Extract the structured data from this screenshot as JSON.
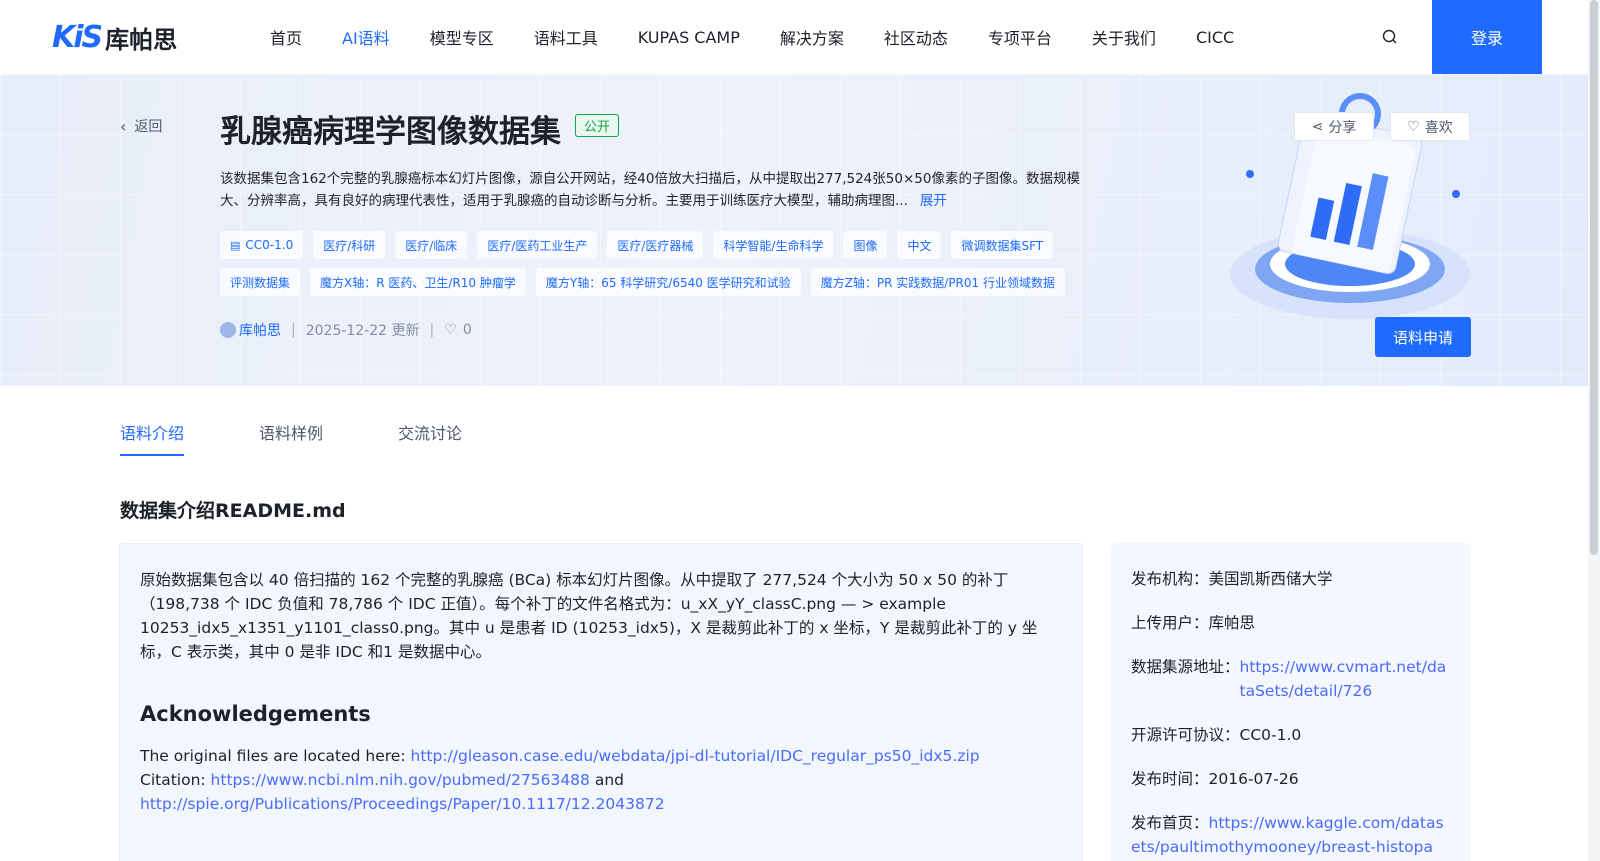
{
  "header": {
    "logo_mark": "KiS",
    "logo_text": "库帕思",
    "nav": [
      "首页",
      "AI语料",
      "模型专区",
      "语料工具",
      "KUPAS CAMP",
      "解决方案",
      "社区动态",
      "专项平台",
      "关于我们",
      "CICC"
    ],
    "active_index": 1,
    "login": "登录"
  },
  "hero": {
    "back": "返回",
    "title": "乳腺癌病理学图像数据集",
    "badge": "公开",
    "description": "该数据集包含162个完整的乳腺癌标本幻灯片图像，源自公开网站，经40倍放大扫描后，从中提取出277,524张50×50像素的子图像。数据规模大、分辨率高，具有良好的病理代表性，适用于乳腺癌的自动诊断与分析。主要用于训练医疗大模型，辅助病理图...",
    "expand": "展开",
    "tags": [
      "CC0-1.0",
      "医疗/科研",
      "医疗/临床",
      "医疗/医药工业生产",
      "医疗/医疗器械",
      "科学智能/生命科学",
      "图像",
      "中文",
      "微调数据集SFT",
      "评测数据集",
      "魔方X轴：R 医药、卫生/R10 肿瘤学",
      "魔方Y轴：65 科学研究/6540 医学研究和试验",
      "魔方Z轴：PR 实践数据/PR01 行业领域数据"
    ],
    "uploader": "库帕思",
    "updated": "2025-12-22 更新",
    "likes": "0",
    "share": "分享",
    "like": "喜欢",
    "apply": "语料申请"
  },
  "tabs": [
    "语料介绍",
    "语料样例",
    "交流讨论"
  ],
  "readme": {
    "section_title": "数据集介绍README.md",
    "body": "原始数据集包含以 40 倍扫描的 162 个完整的乳腺癌 (BCa) 标本幻灯片图像。从中提取了 277,524 个大小为 50 x 50 的补丁（198,738 个 IDC 负值和 78,786 个 IDC 正值）。每个补丁的文件名格式为：u_xX_yY_classC.png — > example 10253_idx5_x1351_y1101_class0.png。其中 u 是患者 ID (10253_idx5)，X 是裁剪此补丁的 x 坐标，Y 是裁剪此补丁的 y 坐标，C 表示类，其中 0 是非 IDC 和1 是数据中心。",
    "ack_title": "Acknowledgements",
    "files_prefix": "The original files are located here: ",
    "files_link": "http://gleason.case.edu/webdata/jpi-dl-tutorial/IDC_regular_ps50_idx5.zip",
    "citation_prefix": "Citation: ",
    "citation_link": "https://www.ncbi.nlm.nih.gov/pubmed/27563488",
    "and": " and",
    "citation_link2": "http://spie.org/Publications/Proceedings/Paper/10.1117/12.2043872"
  },
  "info": {
    "publisher_label": "发布机构：",
    "publisher": "美国凯斯西储大学",
    "uploader_label": "上传用户：",
    "uploader": "库帕思",
    "source_label": "数据集源地址：",
    "source": "https://www.cvmart.net/dataSets/detail/726",
    "license_label": "开源许可协议：",
    "license": "CC0-1.0",
    "date_label": "发布时间：",
    "date": "2016-07-26",
    "home_label": "发布首页：",
    "home": "https://www.kaggle.com/datasets/paultimothymooney/breast-histopa"
  }
}
